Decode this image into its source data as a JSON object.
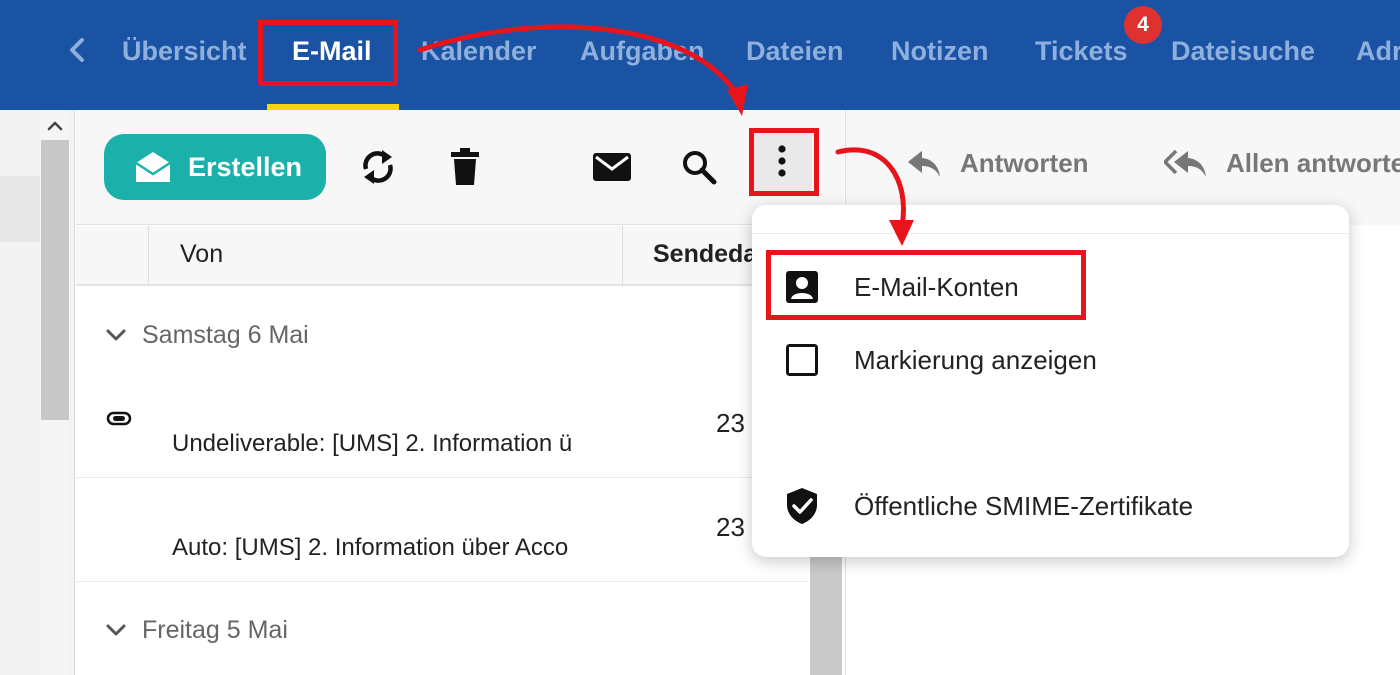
{
  "nav": {
    "tabs": [
      {
        "label": "Übersicht",
        "active": false
      },
      {
        "label": "E-Mail",
        "active": true
      },
      {
        "label": "Kalender",
        "active": false
      },
      {
        "label": "Aufgaben",
        "active": false
      },
      {
        "label": "Dateien",
        "active": false
      },
      {
        "label": "Notizen",
        "active": false
      },
      {
        "label": "Tickets",
        "active": false
      },
      {
        "label": "Dateisuche",
        "active": false
      },
      {
        "label": "Adr",
        "active": false
      }
    ],
    "tickets_badge": "4",
    "back_icon": "chevron-left-icon"
  },
  "toolbar": {
    "create_label": "Erstellen",
    "create_icon": "envelope-open-icon",
    "icons": [
      "refresh-icon",
      "trash-icon",
      "envelope-icon",
      "search-icon",
      "more-vertical-icon"
    ]
  },
  "list": {
    "columns": {
      "from": "Von",
      "date": "Sendeda"
    },
    "groups": [
      {
        "label": "Samstag 6 Mai",
        "mails": [
          {
            "subject": "Undeliverable: [UMS] 2. Information ü",
            "date": "23",
            "has_attachment": true
          },
          {
            "subject": "Auto: [UMS] 2. Information über Acco",
            "date": "23",
            "has_attachment": false
          }
        ]
      },
      {
        "label": "Freitag 5 Mai",
        "mails": []
      }
    ]
  },
  "reading_pane": {
    "reply_label": "Antworten",
    "reply_all_label": "Allen antworte"
  },
  "menu": {
    "items": [
      {
        "label": "E-Mail-Konten",
        "icon": "account-box-icon"
      },
      {
        "label": "Markierung anzeigen",
        "icon": "checkbox-icon"
      },
      {
        "label": "Öffentliche SMIME-Zertifikate",
        "icon": "shield-check-icon"
      }
    ]
  },
  "colors": {
    "topbar": "#1a52a4",
    "accent_teal": "#1bb1aa",
    "highlight_red": "#e8141c",
    "active_underline": "#f5d90a",
    "badge_red": "#e03131"
  }
}
